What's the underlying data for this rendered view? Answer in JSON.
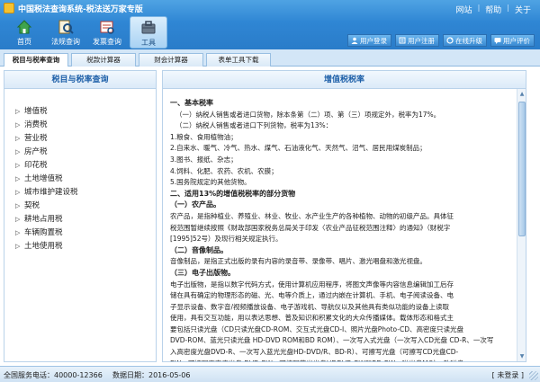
{
  "app": {
    "title": "中国税法查询系统-税法送万家专版",
    "title_links": [
      "网站",
      "帮助",
      "关于"
    ]
  },
  "toolbar": {
    "buttons": [
      {
        "label": "首页",
        "icon": "home-icon"
      },
      {
        "label": "法规查询",
        "icon": "law-search-icon"
      },
      {
        "label": "发票查询",
        "icon": "invoice-search-icon"
      },
      {
        "label": "工具",
        "icon": "tools-icon"
      }
    ],
    "active": "工具"
  },
  "user_actions": {
    "login": "用户登录",
    "register": "用户注册",
    "upgrade": "在线升级",
    "review": "用户评价"
  },
  "tabs": [
    "税目与税率查询",
    "税款计算器",
    "财会计算器",
    "表单工具下载"
  ],
  "sidebar": {
    "title": "税目与税率查询",
    "items": [
      "增值税",
      "消费税",
      "营业税",
      "房产税",
      "印花税",
      "土地增值税",
      "城市维护建设税",
      "契税",
      "耕地占用税",
      "车辆购置税",
      "土地使用税"
    ]
  },
  "content": {
    "title": "增值税税率",
    "lines": [
      {
        "text": "一、基本税率",
        "style": "h"
      },
      {
        "text": "（一）纳税人销售或者进口货物，除本条第（二）项、第（三）项规定外，税率为17%。",
        "style": "ind1"
      },
      {
        "text": "（二）纳税人销售或者进口下列货物，税率为13%：",
        "style": "ind1"
      },
      {
        "text": "1.粮食、食用植物油；",
        "style": ""
      },
      {
        "text": "2.自来水、暖气、冷气、热水、煤气、石油液化气、天然气、沼气、居民用煤炭制品；",
        "style": ""
      },
      {
        "text": "3.图书、报纸、杂志；",
        "style": ""
      },
      {
        "text": "4.饲料、化肥、农药、农机、农膜；",
        "style": ""
      },
      {
        "text": "5.国务院规定的其他货物。",
        "style": ""
      },
      {
        "text": "二、适用13%的增值税税率的部分货物",
        "style": "h"
      },
      {
        "text": "（一）农产品。",
        "style": "h"
      },
      {
        "text": "农产品，是指种植业、养殖业、林业、牧业、水产业生产的各种植物、动物的初级产品。具体征",
        "style": ""
      },
      {
        "text": "税范围暂继续按照《财政部国家税务总局关于印发〈农业产品征税范围注释〉的通知》（财税字",
        "style": ""
      },
      {
        "text": "[1995]52号）及现行相关规定执行。",
        "style": ""
      },
      {
        "text": "（二）音像制品。",
        "style": "h"
      },
      {
        "text": "音像制品，是指正式出版的录有内容的录音带、录像带、唱片、激光唱盘和激光视盘。",
        "style": ""
      },
      {
        "text": "（三）电子出版物。",
        "style": "h"
      },
      {
        "text": "电子出版物，是指以数字代码方式，使用计算机应用程序，将图文声像等内容信息编辑加工后存",
        "style": ""
      },
      {
        "text": "储在具有确定的物理形态的磁、光、电等介质上，通过内嵌在计算机、手机、电子阅读设备、电",
        "style": ""
      },
      {
        "text": "子显示设备、数字音/视频播放设备、电子游戏机、导航仪以及其他具有类似功能的设备上读取",
        "style": ""
      },
      {
        "text": "使用，具有交互功能，用以表达思想、普及知识和积累文化的大众传播媒体。载体形态和格式主",
        "style": ""
      },
      {
        "text": "要包括只读光盘（CD只读光盘CD-ROM、交互式光盘CD-I、照片光盘Photo-CD、高密度只读光盘",
        "style": ""
      },
      {
        "text": "DVD-ROM、蓝光只读光盘 HD-DVD ROM和BD ROM）、一次写入式光盘（一次写入CD光盘 CD-R、一次写",
        "style": ""
      },
      {
        "text": "入高密度光盘DVD-R、一次写入蓝光光盘HD-DVD/R、BD-R）、可擦写光盘（可擦写CD光盘CD-",
        "style": ""
      },
      {
        "text": "RW、可擦写高密度光盘 DVD-RW、可擦写蓝光光盘HDDVD-RW和BD-RW、磁光盘MO）、软磁盘",
        "style": ""
      }
    ]
  },
  "status": {
    "phone": "全国服务电话：40000-12366",
    "date": "数据日期：2016-05-06",
    "registration": "[ 未登录 ]"
  }
}
